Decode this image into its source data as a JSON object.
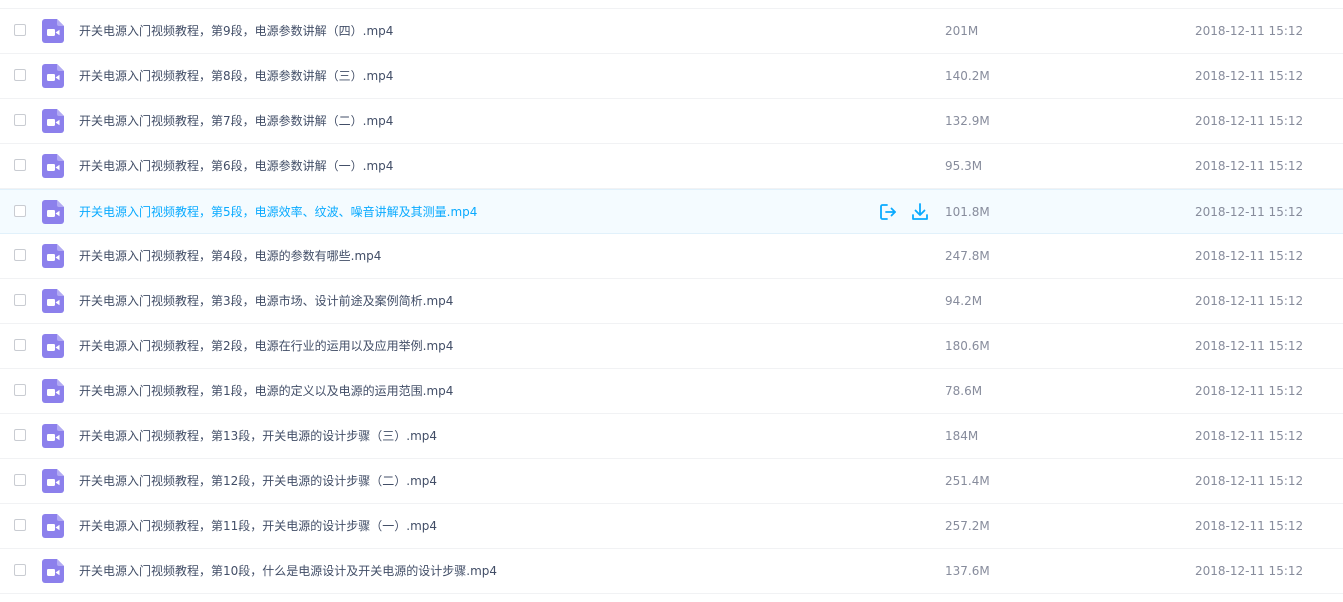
{
  "colors": {
    "accent": "#09aaff",
    "video_icon": "#8c80ec",
    "hover_row_bg": "#f4fbff",
    "text_primary": "#424e67",
    "text_secondary": "#878c9c"
  },
  "row_actions": {
    "share_icon": "share-icon",
    "download_icon": "download-icon"
  },
  "files": [
    {
      "name": "开关电源入门视频教程，第9段，电源参数讲解（四）.mp4",
      "size": "201M",
      "date": "2018-12-11 15:12",
      "icon": "video-file-icon",
      "hovered": false
    },
    {
      "name": "开关电源入门视频教程，第8段，电源参数讲解（三）.mp4",
      "size": "140.2M",
      "date": "2018-12-11 15:12",
      "icon": "video-file-icon",
      "hovered": false
    },
    {
      "name": "开关电源入门视频教程，第7段，电源参数讲解（二）.mp4",
      "size": "132.9M",
      "date": "2018-12-11 15:12",
      "icon": "video-file-icon",
      "hovered": false
    },
    {
      "name": "开关电源入门视频教程，第6段，电源参数讲解（一）.mp4",
      "size": "95.3M",
      "date": "2018-12-11 15:12",
      "icon": "video-file-icon",
      "hovered": false
    },
    {
      "name": "开关电源入门视频教程，第5段，电源效率、纹波、噪音讲解及其测量.mp4",
      "size": "101.8M",
      "date": "2018-12-11 15:12",
      "icon": "video-file-icon",
      "hovered": true
    },
    {
      "name": "开关电源入门视频教程，第4段，电源的参数有哪些.mp4",
      "size": "247.8M",
      "date": "2018-12-11 15:12",
      "icon": "video-file-icon",
      "hovered": false
    },
    {
      "name": "开关电源入门视频教程，第3段，电源市场、设计前途及案例简析.mp4",
      "size": "94.2M",
      "date": "2018-12-11 15:12",
      "icon": "video-file-icon",
      "hovered": false
    },
    {
      "name": "开关电源入门视频教程，第2段，电源在行业的运用以及应用举例.mp4",
      "size": "180.6M",
      "date": "2018-12-11 15:12",
      "icon": "video-file-icon",
      "hovered": false
    },
    {
      "name": "开关电源入门视频教程，第1段，电源的定义以及电源的运用范围.mp4",
      "size": "78.6M",
      "date": "2018-12-11 15:12",
      "icon": "video-file-icon",
      "hovered": false
    },
    {
      "name": "开关电源入门视频教程，第13段，开关电源的设计步骤（三）.mp4",
      "size": "184M",
      "date": "2018-12-11 15:12",
      "icon": "video-file-icon",
      "hovered": false
    },
    {
      "name": "开关电源入门视频教程，第12段，开关电源的设计步骤（二）.mp4",
      "size": "251.4M",
      "date": "2018-12-11 15:12",
      "icon": "video-file-icon",
      "hovered": false
    },
    {
      "name": "开关电源入门视频教程，第11段，开关电源的设计步骤（一）.mp4",
      "size": "257.2M",
      "date": "2018-12-11 15:12",
      "icon": "video-file-icon",
      "hovered": false
    },
    {
      "name": "开关电源入门视频教程，第10段，什么是电源设计及开关电源的设计步骤.mp4",
      "size": "137.6M",
      "date": "2018-12-11 15:12",
      "icon": "video-file-icon",
      "hovered": false
    }
  ]
}
